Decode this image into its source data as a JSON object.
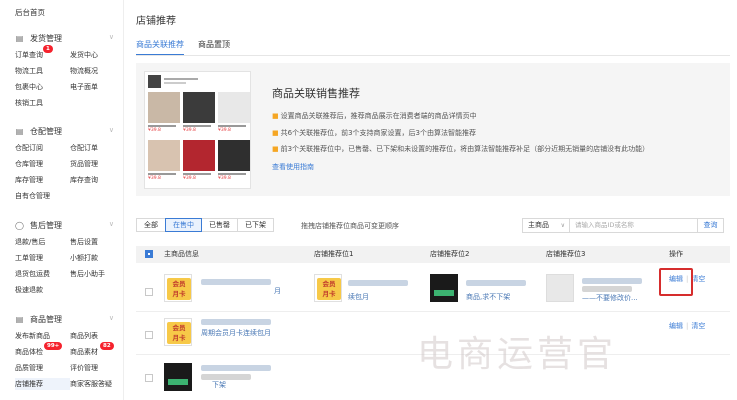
{
  "sidebar": {
    "top_link": "后台首页",
    "sections": [
      {
        "title": "发货管理",
        "icon": "list-icon",
        "items": [
          {
            "label": "订单查询",
            "badge": "1"
          },
          {
            "label": "发货中心",
            "badge": ""
          },
          {
            "label": "物流工具",
            "badge": ""
          },
          {
            "label": "物流概况",
            "badge": ""
          },
          {
            "label": "包裹中心",
            "badge": ""
          },
          {
            "label": "电子面单",
            "badge": ""
          },
          {
            "label": "核销工具",
            "badge": ""
          }
        ]
      },
      {
        "title": "仓配管理",
        "icon": "list-icon",
        "items": [
          {
            "label": "仓配订阅",
            "badge": ""
          },
          {
            "label": "仓配订单",
            "badge": ""
          },
          {
            "label": "仓库管理",
            "badge": ""
          },
          {
            "label": "货品管理",
            "badge": ""
          },
          {
            "label": "库存管理",
            "badge": ""
          },
          {
            "label": "库存查询",
            "badge": ""
          },
          {
            "label": "自有仓管理",
            "badge": ""
          }
        ]
      },
      {
        "title": "售后管理",
        "icon": "shield-icon",
        "items": [
          {
            "label": "退款/售后",
            "badge": ""
          },
          {
            "label": "售后设置",
            "badge": ""
          },
          {
            "label": "工单管理",
            "badge": ""
          },
          {
            "label": "小额打款",
            "badge": ""
          },
          {
            "label": "退货包运费",
            "badge": ""
          },
          {
            "label": "售后小助手",
            "badge": ""
          },
          {
            "label": "极速退款",
            "badge": ""
          }
        ]
      },
      {
        "title": "商品管理",
        "icon": "list-icon",
        "items": [
          {
            "label": "发布新商品",
            "badge": ""
          },
          {
            "label": "商品列表",
            "badge": ""
          },
          {
            "label": "商品体检",
            "badge": "99+"
          },
          {
            "label": "商品素材",
            "badge": "82"
          },
          {
            "label": "品质管理",
            "badge": ""
          },
          {
            "label": "评价管理",
            "badge": ""
          },
          {
            "label": "店铺推荐",
            "badge": ""
          },
          {
            "label": "商家客服答疑",
            "badge": ""
          }
        ]
      }
    ]
  },
  "page": {
    "title": "店铺推荐",
    "tabs": [
      "商品关联推荐",
      "商品置顶"
    ]
  },
  "promo": {
    "title": "商品关联销售推荐",
    "items": [
      "设置商品关联推荐后，推荐商品展示在消费者端的商品详情页中",
      "共6个关联推荐位，前3个支持商家设置，后3个由算法智能推荐",
      "前3个关联推荐位中，已售罄、已下架和未设置的推荐位，将由算法智能推荐补足（部分近期无销量的店铺没有此功能）"
    ],
    "link": "查看使用指南",
    "mock_prices": [
      "¥39.8",
      "¥39.8",
      "¥39.8",
      "¥39.8",
      "¥39.8",
      "¥39.8"
    ]
  },
  "filter": {
    "buttons": [
      "全部",
      "在售中",
      "已售罄",
      "已下架"
    ],
    "active": "在售中",
    "hint": "拖拽店铺推荐位商品可变更顺序",
    "select_value": "主商品",
    "search_placeholder": "请输入商品ID或名称",
    "search_button": "查询"
  },
  "table": {
    "headers": [
      "主商品信息",
      "店铺推荐位1",
      "店铺推荐位2",
      "店铺推荐位3",
      "操作"
    ],
    "card_text": "会员\n月卡",
    "rows": [
      {
        "main_text": "月",
        "slot1_text": "续包月",
        "slot2_text": "商品,求不下架",
        "slot3_text": "——不要修改价...",
        "ops": [
          "编辑",
          "清空"
        ]
      },
      {
        "main_text": "周期会员月卡连续包月",
        "ops": [
          "编辑",
          "清空"
        ]
      },
      {
        "main_text": "下架"
      }
    ]
  },
  "watermark": "电商运营官"
}
